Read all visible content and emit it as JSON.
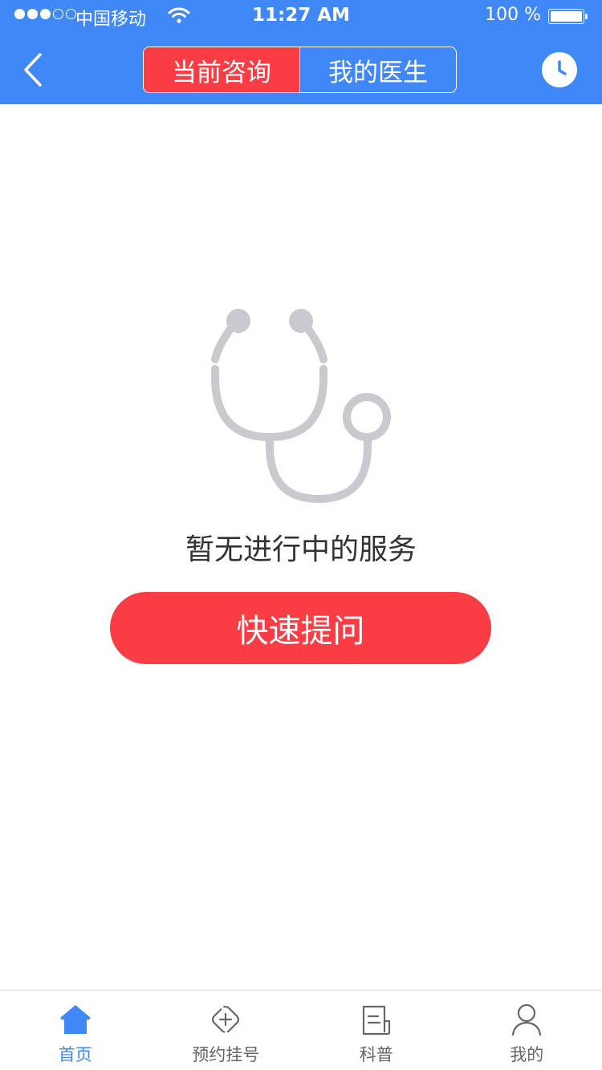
{
  "status_bar": {
    "carrier": "中国移动",
    "time": "11:27 AM",
    "battery": "100 %"
  },
  "nav": {
    "tabs": [
      {
        "label": "当前咨询",
        "active": true
      },
      {
        "label": "我的医生",
        "active": false
      }
    ],
    "back_icon": "chevron-left-icon",
    "history_icon": "clock-icon"
  },
  "empty_state": {
    "icon": "stethoscope-icon",
    "message": "暂无进行中的服务",
    "button_label": "快速提问"
  },
  "tabbar": {
    "items": [
      {
        "label": "首页",
        "icon": "home-icon",
        "active": true
      },
      {
        "label": "预约挂号",
        "icon": "appointment-icon",
        "active": false
      },
      {
        "label": "科普",
        "icon": "article-icon",
        "active": false
      },
      {
        "label": "我的",
        "icon": "profile-icon",
        "active": false
      }
    ]
  },
  "colors": {
    "primary_blue": "#4088f8",
    "accent_red": "#fa3d45",
    "icon_gray": "#c8cad0"
  }
}
